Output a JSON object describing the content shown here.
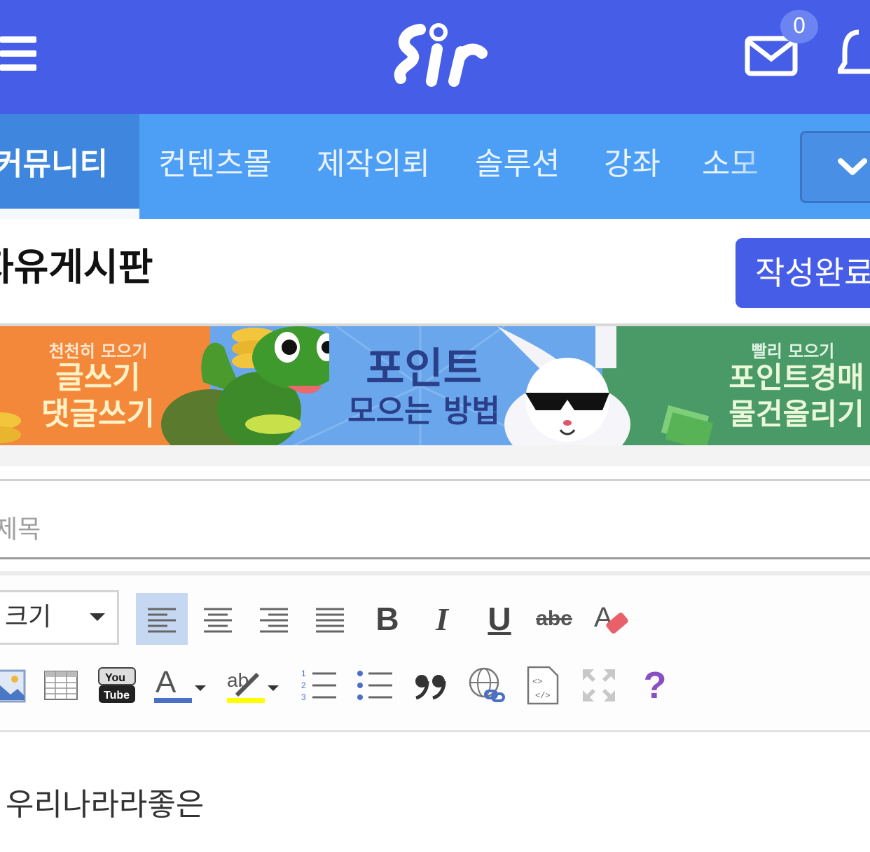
{
  "header": {
    "logo": "sir",
    "mail_count": "0",
    "icons": [
      "menu-icon",
      "mail-icon",
      "bell-icon"
    ]
  },
  "nav": {
    "items": [
      "커뮤니티",
      "컨텐츠몰",
      "제작의뢰",
      "솔루션",
      "강좌",
      "소모"
    ],
    "active_index": 0,
    "more_icon": "chevron-down-icon"
  },
  "page": {
    "board_title": "자유게시판",
    "submit_label": "작성완료"
  },
  "banner": {
    "left_small": "천천히 모으기",
    "left_line1": "글쓰기",
    "left_line2": "댓글쓰기",
    "mid_line1": "포인트",
    "mid_line2": "모으는 방법",
    "right_small": "빨리 모으기",
    "right_line1": "포인트경매",
    "right_line2": "물건올리기"
  },
  "form": {
    "title_placeholder": "제목"
  },
  "editor": {
    "font_size_label": "크기",
    "toolbar_row1": [
      "align-left-icon",
      "align-center-icon",
      "align-right-icon",
      "align-justify-icon",
      "bold-icon",
      "italic-icon",
      "underline-icon",
      "strikethrough-icon",
      "clear-format-icon"
    ],
    "toolbar_row2": [
      "image-icon",
      "table-icon",
      "youtube-icon",
      "font-color-icon",
      "highlight-icon",
      "ordered-list-icon",
      "unordered-list-icon",
      "quote-icon",
      "link-icon",
      "code-view-icon",
      "fullscreen-icon",
      "help-icon"
    ],
    "bold_glyph": "B",
    "italic_glyph": "I",
    "underline_glyph": "U",
    "strike_glyph": "abc",
    "help_glyph": "?",
    "content": "우리나라라좋은",
    "colors": {
      "font_color": "#4a6fc7",
      "highlight": "#ffff00",
      "help": "#8a4fc2"
    }
  }
}
